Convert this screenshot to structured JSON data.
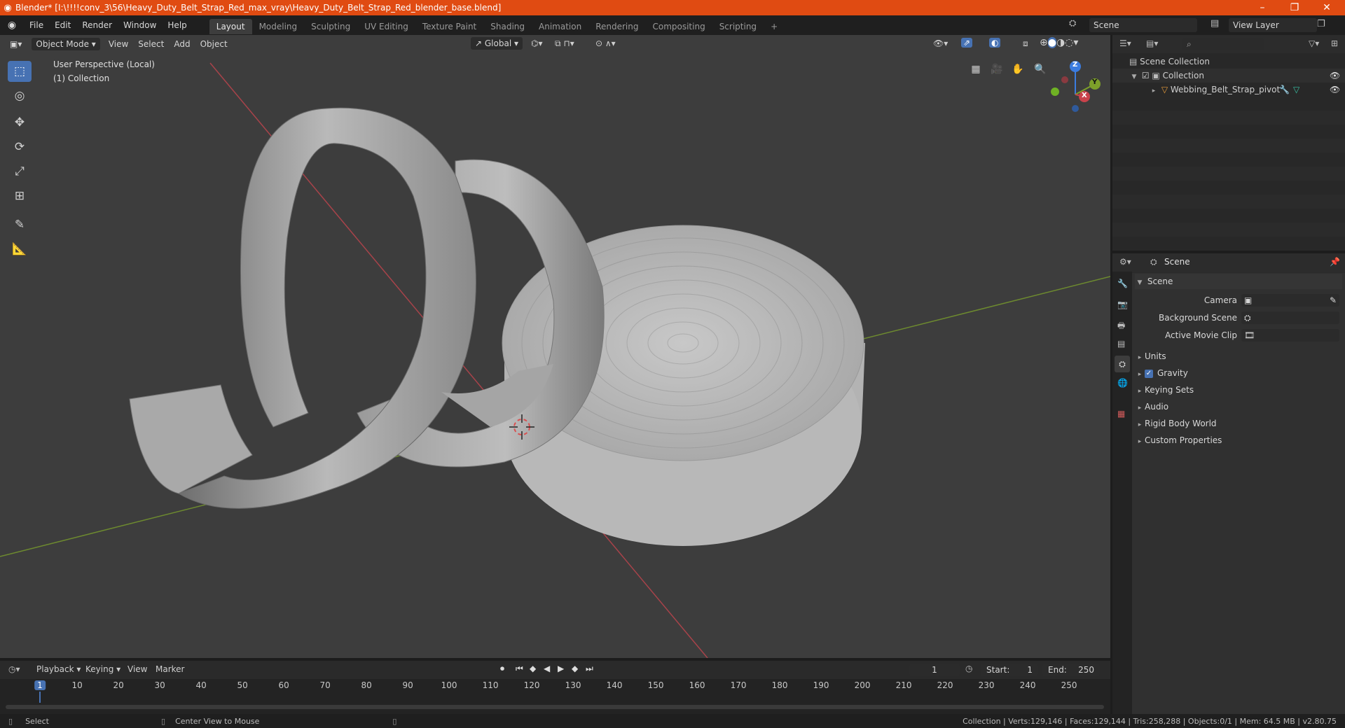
{
  "window": {
    "title": "Blender* [I:\\!!!!conv_3\\56\\Heavy_Duty_Belt_Strap_Red_max_vray\\Heavy_Duty_Belt_Strap_Red_blender_base.blend]",
    "minimize": "–",
    "maximize": "❐",
    "close": "✕"
  },
  "menu": {
    "items": [
      "File",
      "Edit",
      "Render",
      "Window",
      "Help"
    ]
  },
  "workspaces": {
    "tabs": [
      "Layout",
      "Modeling",
      "Sculpting",
      "UV Editing",
      "Texture Paint",
      "Shading",
      "Animation",
      "Rendering",
      "Compositing",
      "Scripting"
    ],
    "active": "Layout",
    "add": "+"
  },
  "scene_selector": {
    "value": "Scene"
  },
  "view_layer": {
    "value": "View Layer"
  },
  "viewport": {
    "mode": "Object Mode",
    "menus": [
      "View",
      "Select",
      "Add",
      "Object"
    ],
    "orientation": "Global",
    "overlay_title": "User Perspective (Local)",
    "overlay_collection": "(1) Collection",
    "gizmo": {
      "x": "X",
      "y": "Y",
      "z": "Z"
    }
  },
  "outliner": {
    "root": "Scene Collection",
    "collection": "Collection",
    "object": "Webbing_Belt_Strap_pivot"
  },
  "properties": {
    "header": "Scene",
    "section": "Scene",
    "fields": [
      {
        "label": "Camera",
        "value": ""
      },
      {
        "label": "Background Scene",
        "value": ""
      },
      {
        "label": "Active Movie Clip",
        "value": ""
      }
    ],
    "panels": [
      "Units",
      "Gravity",
      "Keying Sets",
      "Audio",
      "Rigid Body World",
      "Custom Properties"
    ],
    "gravity_checked": true
  },
  "timeline": {
    "menus": [
      "Playback",
      "Keying",
      "View",
      "Marker"
    ],
    "current_frame": "1",
    "start_label": "Start:",
    "start": "1",
    "end_label": "End:",
    "end": "250",
    "ruler": [
      "1",
      "10",
      "20",
      "30",
      "40",
      "50",
      "60",
      "70",
      "80",
      "90",
      "100",
      "110",
      "120",
      "130",
      "140",
      "150",
      "160",
      "170",
      "180",
      "190",
      "200",
      "210",
      "220",
      "230",
      "240",
      "250"
    ]
  },
  "status": {
    "left": "Select",
    "middle": "Center View to Mouse",
    "stats": "Collection | Verts:129,146 | Faces:129,144 | Tris:258,288 | Objects:0/1 | Mem: 64.5 MB | v2.80.75"
  },
  "colors": {
    "titlebar": "#e04b12",
    "accent": "#4772b3",
    "x_axis": "#c9424b",
    "y_axis": "#7da02a",
    "z_axis": "#3b7ce0"
  }
}
